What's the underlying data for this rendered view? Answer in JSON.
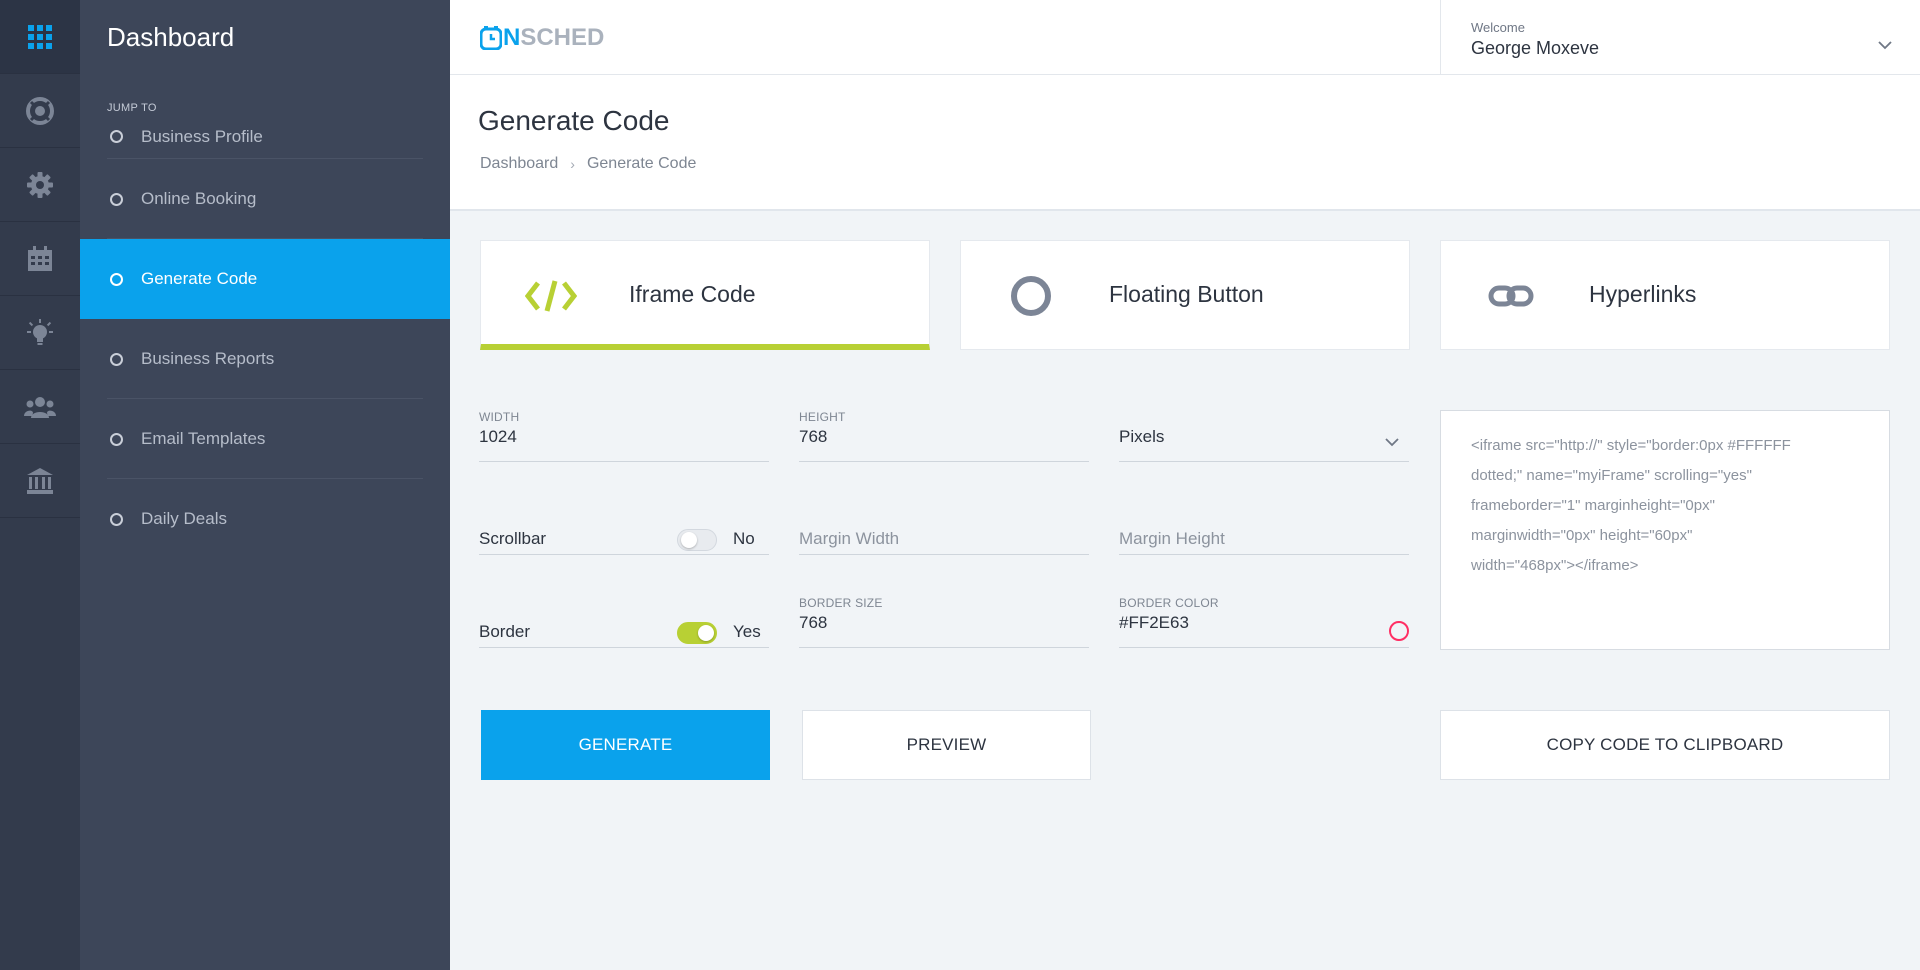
{
  "sidebar": {
    "title": "Dashboard",
    "jump_label": "JUMP TO",
    "items": [
      {
        "label": "Business Profile"
      },
      {
        "label": "Online Booking"
      },
      {
        "label": "Generate Code"
      },
      {
        "label": "Business Reports"
      },
      {
        "label": "Email Templates"
      },
      {
        "label": "Daily Deals"
      }
    ],
    "active_index": 2
  },
  "rail": {
    "icons": [
      "grid-icon",
      "support-icon",
      "gear-icon",
      "calendar-icon",
      "lightbulb-icon",
      "users-icon",
      "bank-icon"
    ]
  },
  "header": {
    "logo_n": "N",
    "logo_rest": "SCHED",
    "welcome": "Welcome",
    "username": "George Moxeve"
  },
  "page": {
    "title": "Generate Code",
    "breadcrumb": [
      "Dashboard",
      "Generate Code"
    ]
  },
  "cards": [
    {
      "label": "Iframe Code",
      "icon": "code-icon",
      "active": true
    },
    {
      "label": "Floating Button",
      "icon": "circle-icon",
      "active": false
    },
    {
      "label": "Hyperlinks",
      "icon": "link-icon",
      "active": false
    }
  ],
  "form": {
    "width": {
      "label": "WIDTH",
      "value": "1024"
    },
    "height": {
      "label": "HEIGHT",
      "value": "768"
    },
    "unit": {
      "value": "Pixels"
    },
    "scrollbar": {
      "label": "Scrollbar",
      "state": "No",
      "on": false
    },
    "margin_width": {
      "placeholder": "Margin Width"
    },
    "margin_height": {
      "placeholder": "Margin Height"
    },
    "border": {
      "label": "Border",
      "state": "Yes",
      "on": true
    },
    "border_size": {
      "label": "BORDER SIZE",
      "value": "768"
    },
    "border_color": {
      "label": "BORDER COLOR",
      "value": "#FF2E63"
    }
  },
  "code": {
    "text": "<iframe src=\"http://\" style=\"border:0px #FFFFFF\ndotted;\" name=\"myiFrame\" scrolling=\"yes\"\nframeborder=\"1\" marginheight=\"0px\"\nmarginwidth=\"0px\" height=\"60px\"\nwidth=\"468px\"></iframe>"
  },
  "buttons": {
    "generate": "GENERATE",
    "preview": "PREVIEW",
    "copy": "COPY CODE TO CLIPBOARD"
  },
  "colors": {
    "accent": "#0aa2ec",
    "active_tab": "#b8d034",
    "border_color_swatch": "#ff2e63",
    "sidebar_bg": "#3d4659",
    "rail_bg": "#333b4c"
  }
}
